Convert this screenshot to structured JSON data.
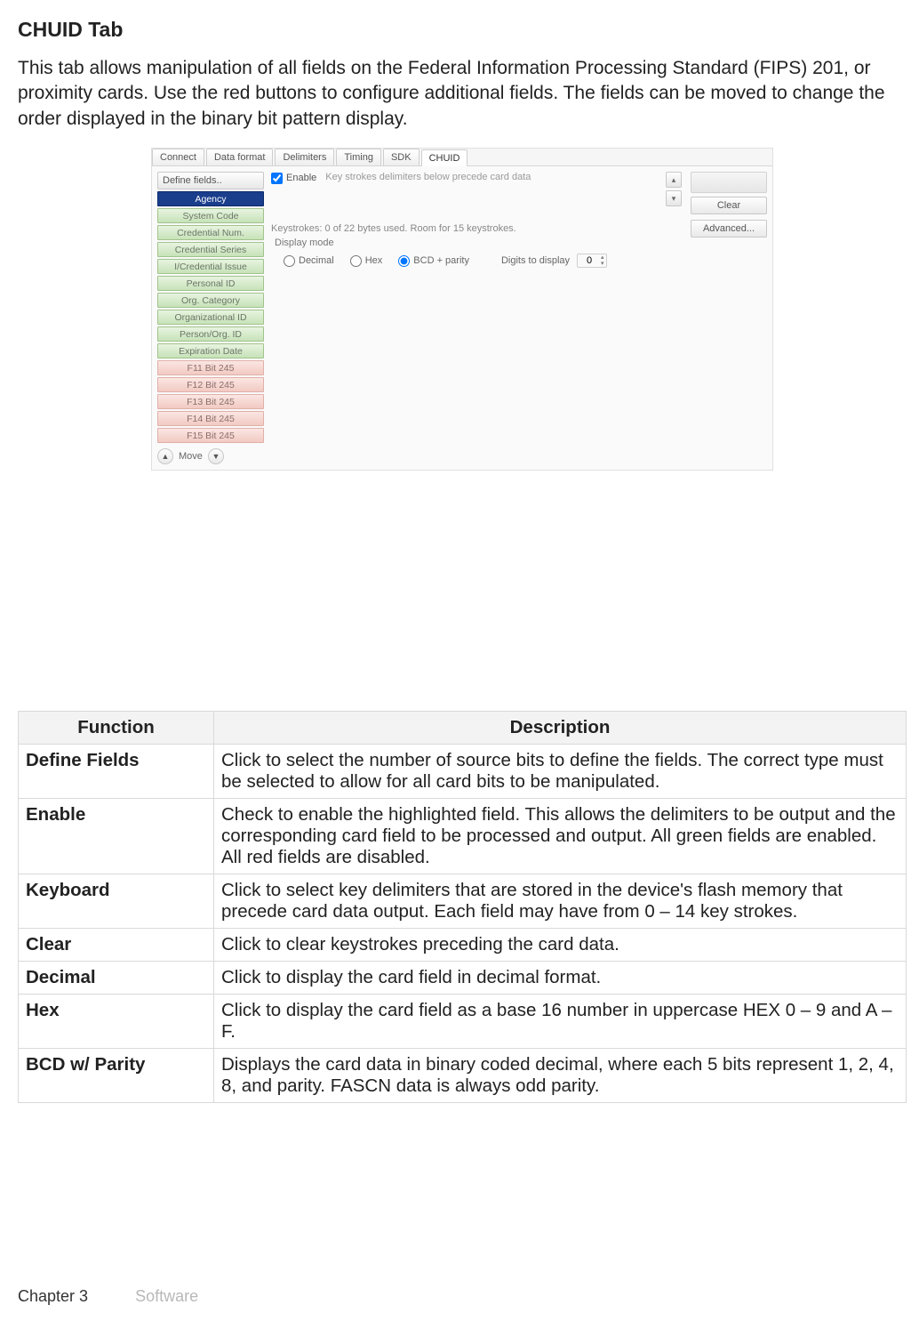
{
  "page": {
    "title": "CHUID Tab",
    "intro": "This tab allows manipulation of all fields on the Federal Information Processing Standard (FIPS) 201, or proximity cards. Use the red buttons to configure additional fields. The fields can be moved to change the order displayed in the binary bit pattern display."
  },
  "screenshot": {
    "tabs": [
      "Connect",
      "Data format",
      "Delimiters",
      "Timing",
      "SDK",
      "CHUID"
    ],
    "active_tab_index": 5,
    "define_fields_label": "Define fields..",
    "fields": [
      {
        "label": "Agency",
        "cls": "sel"
      },
      {
        "label": "System Code",
        "cls": "green"
      },
      {
        "label": "Credential Num.",
        "cls": "green"
      },
      {
        "label": "Credential Series",
        "cls": "green"
      },
      {
        "label": "I/Credential Issue",
        "cls": "green"
      },
      {
        "label": "Personal ID",
        "cls": "green"
      },
      {
        "label": "Org. Category",
        "cls": "green"
      },
      {
        "label": "Organizational ID",
        "cls": "green"
      },
      {
        "label": "Person/Org. ID",
        "cls": "green"
      },
      {
        "label": "Expiration Date",
        "cls": "green"
      },
      {
        "label": "F11 Bit 245",
        "cls": "red"
      },
      {
        "label": "F12 Bit 245",
        "cls": "red"
      },
      {
        "label": "F13 Bit 245",
        "cls": "red"
      },
      {
        "label": "F14 Bit 245",
        "cls": "red"
      },
      {
        "label": "F15 Bit 245",
        "cls": "red"
      }
    ],
    "move_label": "Move",
    "enable_label": "Enable",
    "hint": "Key strokes delimiters below precede card data",
    "clear_label": "Clear",
    "advanced_label": "Advanced...",
    "keystrokes_info": "Keystrokes: 0 of 22 bytes used. Room for 15 keystrokes.",
    "display_mode_label": "Display mode",
    "radios": {
      "decimal": "Decimal",
      "hex": "Hex",
      "bcd": "BCD + parity"
    },
    "digits_label": "Digits to display",
    "digits_value": "0"
  },
  "table": {
    "headers": [
      "Function",
      "Description"
    ],
    "rows": [
      {
        "func": "Define Fields",
        "desc": "Click to select the number of source bits to define the fields. The correct type must be selected to allow for all card bits to be manipulated."
      },
      {
        "func": "Enable",
        "desc": "Check to enable the highlighted field. This allows the delimiters to be output and the corresponding card field to be processed and output. All green fields are enabled. All red fields are disabled."
      },
      {
        "func": "Keyboard",
        "desc": "Click to select key delimiters that are stored in the device's flash memory that precede card data output. Each field may have from 0 – 14 key strokes."
      },
      {
        "func": "Clear",
        "desc": "Click to clear keystrokes preceding the card data."
      },
      {
        "func": "Decimal",
        "desc": "Click to display the card field in decimal format."
      },
      {
        "func": "Hex",
        "desc": "Click to display the card field as a base 16 number in uppercase HEX 0 – 9 and A – F."
      },
      {
        "func": "BCD w/ Parity",
        "desc": "Displays the card data in binary coded decimal, where each 5 bits represent 1, 2, 4, 8, and parity. FASCN data is always odd parity."
      }
    ]
  },
  "footer": {
    "chapter": "Chapter 3",
    "section": "Software"
  }
}
